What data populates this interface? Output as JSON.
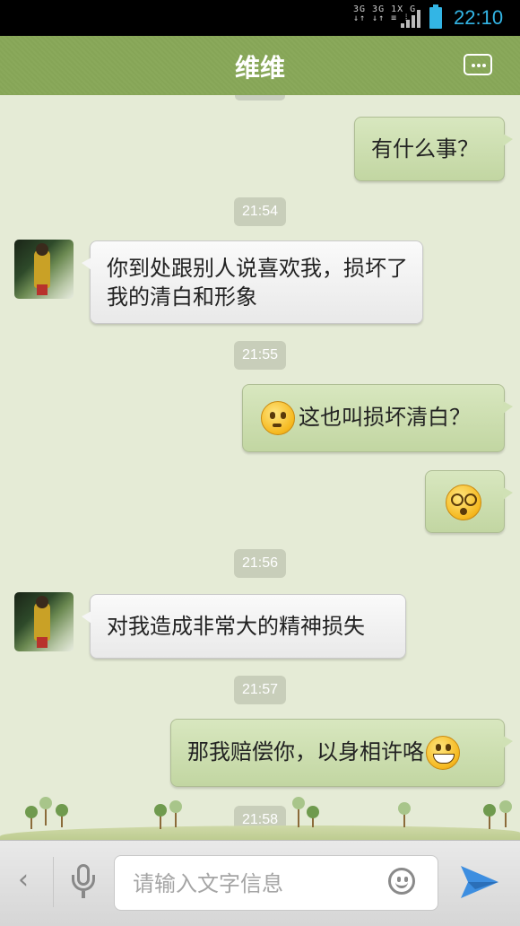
{
  "status_bar": {
    "network_text": "3G 3G 1X G",
    "time": "22:10",
    "accent_color": "#33b5e5"
  },
  "header": {
    "title": "维维",
    "more_icon": "more-icon"
  },
  "messages": [
    {
      "type": "text",
      "side": "me",
      "text": "有什么事？"
    },
    {
      "type": "timestamp",
      "text": "21:54"
    },
    {
      "type": "text",
      "side": "them",
      "text": "你到处跟别人说喜欢我，损坏了我的清白和形象"
    },
    {
      "type": "timestamp",
      "text": "21:55"
    },
    {
      "type": "text",
      "side": "me",
      "emoji": "thinking-emoji",
      "text": "这也叫损坏清白？"
    },
    {
      "type": "emoji",
      "side": "me",
      "emoji": "dizzy-emoji"
    },
    {
      "type": "timestamp",
      "text": "21:56"
    },
    {
      "type": "text",
      "side": "them",
      "text": "对我造成非常大的精神损失"
    },
    {
      "type": "timestamp",
      "text": "21:57"
    },
    {
      "type": "text",
      "side": "me",
      "emoji_after": "grin-emoji",
      "text": "那我赔偿你，以身相许咯"
    },
    {
      "type": "timestamp",
      "text": "21:58"
    }
  ],
  "input_bar": {
    "back_icon": "back-chevron-icon",
    "back_glyph": "‹",
    "voice_icon": "microphone-icon",
    "placeholder": "请输入文字信息",
    "value": "",
    "emoji_icon": "smiley-icon",
    "send_icon": "send-icon",
    "send_color": "#3d8ee0"
  }
}
